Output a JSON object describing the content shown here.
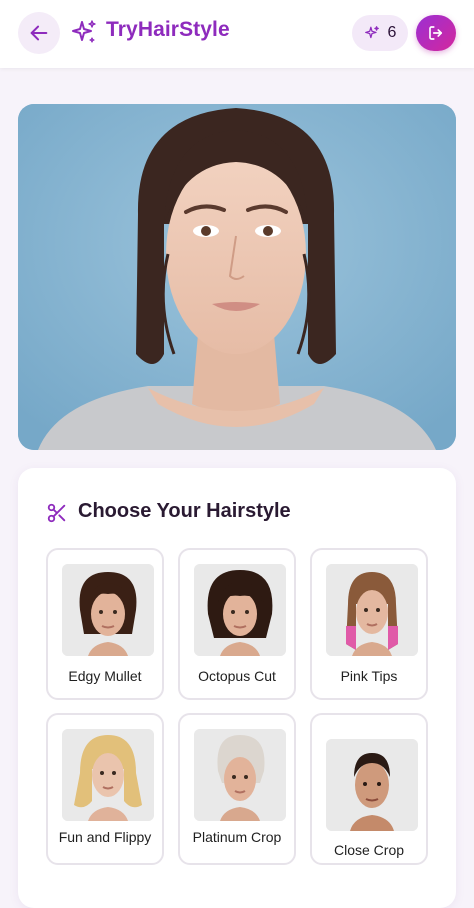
{
  "header": {
    "title": "TryHairStyle",
    "credits": "6",
    "back_icon": "arrow-left-icon",
    "brand_icon": "sparkles-icon",
    "logout_icon": "logout-icon"
  },
  "colors": {
    "brand": "#8e2bbd",
    "gradient_start": "#9b2fd3",
    "gradient_end": "#d4279d"
  },
  "panel": {
    "title": "Choose Your Hairstyle",
    "icon": "scissors-icon"
  },
  "hairstyles": [
    {
      "label": "Edgy Mullet"
    },
    {
      "label": "Octopus Cut"
    },
    {
      "label": "Pink Tips"
    },
    {
      "label": "Fun and Flippy"
    },
    {
      "label": "Platinum Crop"
    },
    {
      "label": "Close Crop"
    }
  ]
}
